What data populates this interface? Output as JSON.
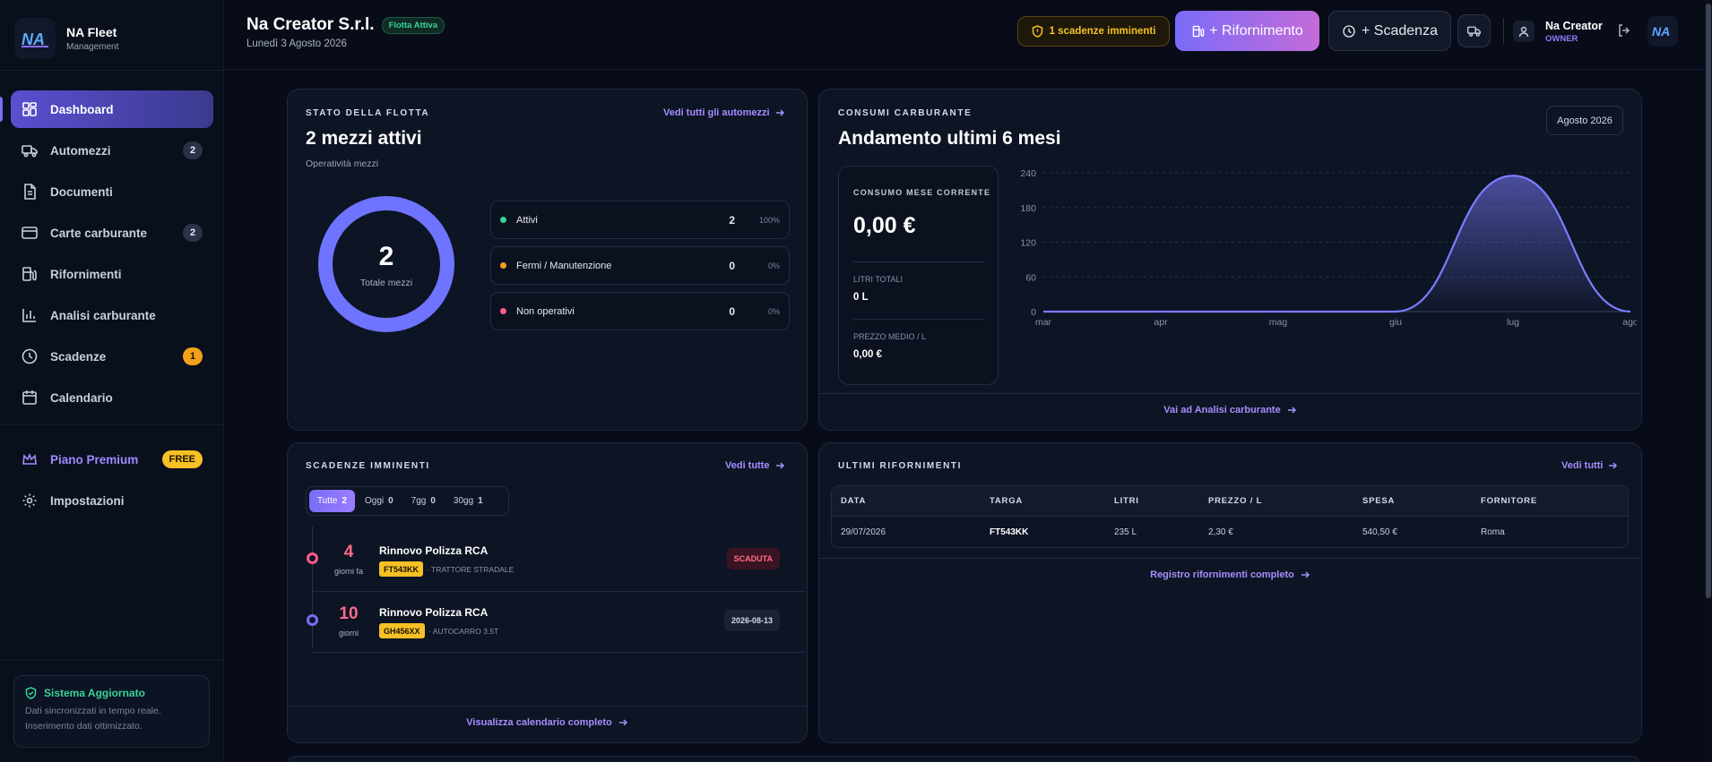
{
  "brand": {
    "title": "NA Fleet",
    "subtitle": "Management"
  },
  "sidebar": {
    "items": [
      {
        "label": "Dashboard",
        "icon": "dashboard-icon",
        "badge": ""
      },
      {
        "label": "Automezzi",
        "icon": "truck-icon",
        "badge": "2"
      },
      {
        "label": "Documenti",
        "icon": "document-icon",
        "badge": ""
      },
      {
        "label": "Carte carburante",
        "icon": "card-icon",
        "badge": "2"
      },
      {
        "label": "Rifornimenti",
        "icon": "fuel-icon",
        "badge": ""
      },
      {
        "label": "Analisi carburante",
        "icon": "bar-chart-icon",
        "badge": ""
      },
      {
        "label": "Scadenze",
        "icon": "clock-icon",
        "badge": "1"
      },
      {
        "label": "Calendario",
        "icon": "calendar-icon",
        "badge": ""
      }
    ],
    "premium": {
      "label": "Piano Premium",
      "badge": "FREE"
    },
    "settings": {
      "label": "Impostazioni"
    },
    "status": {
      "title": "Sistema Aggiornato",
      "line1": "Dati sincronizzati in tempo reale.",
      "line2": "Inserimento dati ottimizzato."
    }
  },
  "header": {
    "company": "Na Creator S.r.l.",
    "fleet_badge": "Flotta Attiva",
    "date": "Lunedì 3 Agosto 2026",
    "alert": "1 scadenze imminenti",
    "rifornimento_btn": "+ Rifornimento",
    "scadenza_btn": "+ Scadenza",
    "user_name": "Na Creator",
    "user_role": "OWNER"
  },
  "fleet": {
    "label": "STATO DELLA FLOTTA",
    "link": "Vedi tutti gli automezzi",
    "title": "2 mezzi attivi",
    "subtitle": "Operatività mezzi",
    "total": "2",
    "total_label": "Totale mezzi",
    "active_fraction": 1.0,
    "rows": [
      {
        "name": "Attivi",
        "value": "2",
        "pct": "100%",
        "color": "#37d399"
      },
      {
        "name": "Fermi / Manutenzione",
        "value": "0",
        "pct": "0%",
        "color": "#f4a01b"
      },
      {
        "name": "Non operativi",
        "value": "0",
        "pct": "0%",
        "color": "#ff5c8a"
      }
    ],
    "donut_color": "#6e74ff"
  },
  "consumi": {
    "label": "CONSUMI CARBURANTE",
    "title": "Andamento ultimi 6 mesi",
    "month": "Agosto 2026",
    "kpi_label": "CONSUMO MESE CORRENTE",
    "kpi_value": "0,00 €",
    "litri_label": "LITRI TOTALI",
    "litri_value": "0 L",
    "prezzo_label": "PREZZO MEDIO / L",
    "prezzo_value": "0,00 €",
    "footer": "Vai ad Analisi carburante"
  },
  "chart_data": {
    "type": "area",
    "categories": [
      "mar",
      "apr",
      "mag",
      "giu",
      "lug",
      "ago"
    ],
    "series": [
      {
        "values": [
          0,
          0,
          0,
          0,
          235,
          0
        ]
      }
    ],
    "ylim": [
      0,
      240
    ],
    "yticks": [
      0,
      60,
      120,
      180,
      240
    ],
    "grid": true,
    "color": "#7b7dff"
  },
  "scadenze": {
    "label": "SCADENZE IMMINENTI",
    "link": "Vedi tutte",
    "filters": [
      {
        "label": "Tutte",
        "count": "2"
      },
      {
        "label": "Oggi",
        "count": "0"
      },
      {
        "label": "7gg",
        "count": "0"
      },
      {
        "label": "30gg",
        "count": "1"
      }
    ],
    "items": [
      {
        "days": "4",
        "unit": "giorni fa",
        "title": "Rinnovo Polizza RCA",
        "plate": "FT543KK",
        "type": "· TRATTORE STRADALE",
        "badge": "SCADUTA",
        "dot_color": "#ff5c8a"
      },
      {
        "days": "10",
        "unit": "giorni",
        "title": "Rinnovo Polizza RCA",
        "plate": "GH456XX",
        "type": "· AUTOCARRO 3.5T",
        "badge": "2026-08-13",
        "dot_color": "#7b6cf6"
      }
    ],
    "footer": "Visualizza calendario completo"
  },
  "rifornimenti": {
    "label": "ULTIMI RIFORNIMENTI",
    "link": "Vedi tutti",
    "columns": [
      "DATA",
      "TARGA",
      "LITRI",
      "PREZZO / L",
      "SPESA",
      "FORNITORE"
    ],
    "rows": [
      [
        "29/07/2026",
        "FT543KK",
        "235 L",
        "2,30 €",
        "540,50 €",
        "Roma"
      ]
    ],
    "footer": "Registro rifornimenti completo"
  }
}
